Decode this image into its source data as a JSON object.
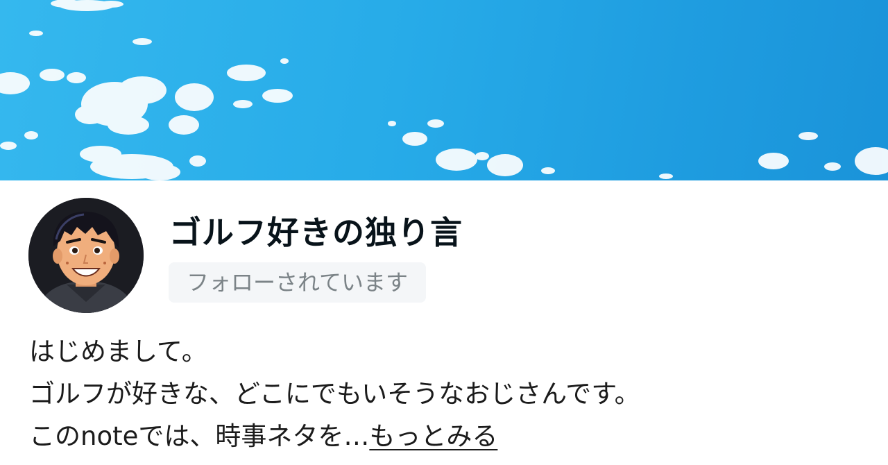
{
  "header": {
    "image": "blue-sky-with-clouds"
  },
  "profile": {
    "avatar": "cartoon-man-avatar",
    "name": "ゴルフ好きの独り言",
    "follow_status": "フォローされています"
  },
  "bio": {
    "line1": "はじめまして。",
    "line2": "ゴルフが好きな、どこにでもいそうなおじさんです。",
    "line3": "このnoteでは、時事ネタを…",
    "more_link": "もっとみる"
  },
  "colors": {
    "sky_top": "#35b8ee",
    "sky_right": "#1a93d9",
    "name_text": "#08131a",
    "badge_bg": "#f4f6f8",
    "badge_text": "#7b8387"
  }
}
